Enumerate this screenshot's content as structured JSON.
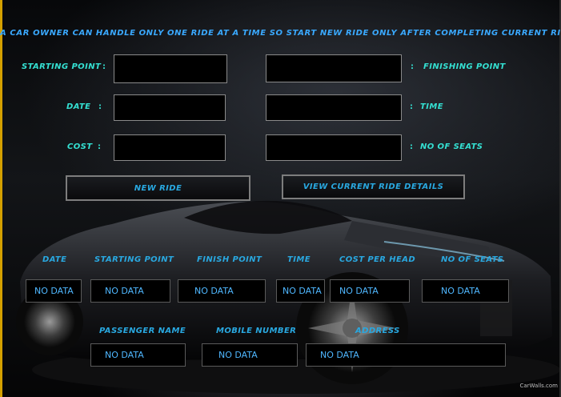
{
  "header": {
    "notice": "A CAR OWNER CAN HANDLE ONLY ONE RIDE AT A TIME SO START NEW RIDE ONLY AFTER COMPLETING CURRENT RIDE"
  },
  "form": {
    "starting_point_label": "STARTING POINT",
    "finishing_point_label": "FINISHING POINT",
    "date_label": "DATE",
    "time_label": "TIME",
    "cost_label": "COST",
    "seats_label": "NO OF SEATS",
    "colon": ":",
    "starting_point_value": "",
    "finishing_point_value": "",
    "date_value": "",
    "time_value": "",
    "cost_value": "",
    "seats_value": ""
  },
  "buttons": {
    "new_ride": "NEW RIDE",
    "view_current": "VIEW CURRENT RIDE DETAILS"
  },
  "ride_details": {
    "headers": [
      "DATE",
      "STARTING POINT",
      "FINISH POINT",
      "TIME",
      "COST PER HEAD",
      "NO OF SEATS"
    ],
    "values": [
      "NO DATA",
      "NO DATA",
      "NO DATA",
      "NO DATA",
      "NO DATA",
      "NO DATA"
    ]
  },
  "passenger": {
    "headers": [
      "PASSENGER NAME",
      "MOBILE NUMBER",
      "ADDRESS"
    ],
    "values": [
      "NO DATA",
      "NO DATA",
      "NO DATA"
    ]
  },
  "watermark": "CarWalls.com",
  "colors": {
    "label_teal": "#34e0d2",
    "label_blue": "#29a8e0",
    "data_text": "#4fb7ff",
    "background": "#000000"
  }
}
